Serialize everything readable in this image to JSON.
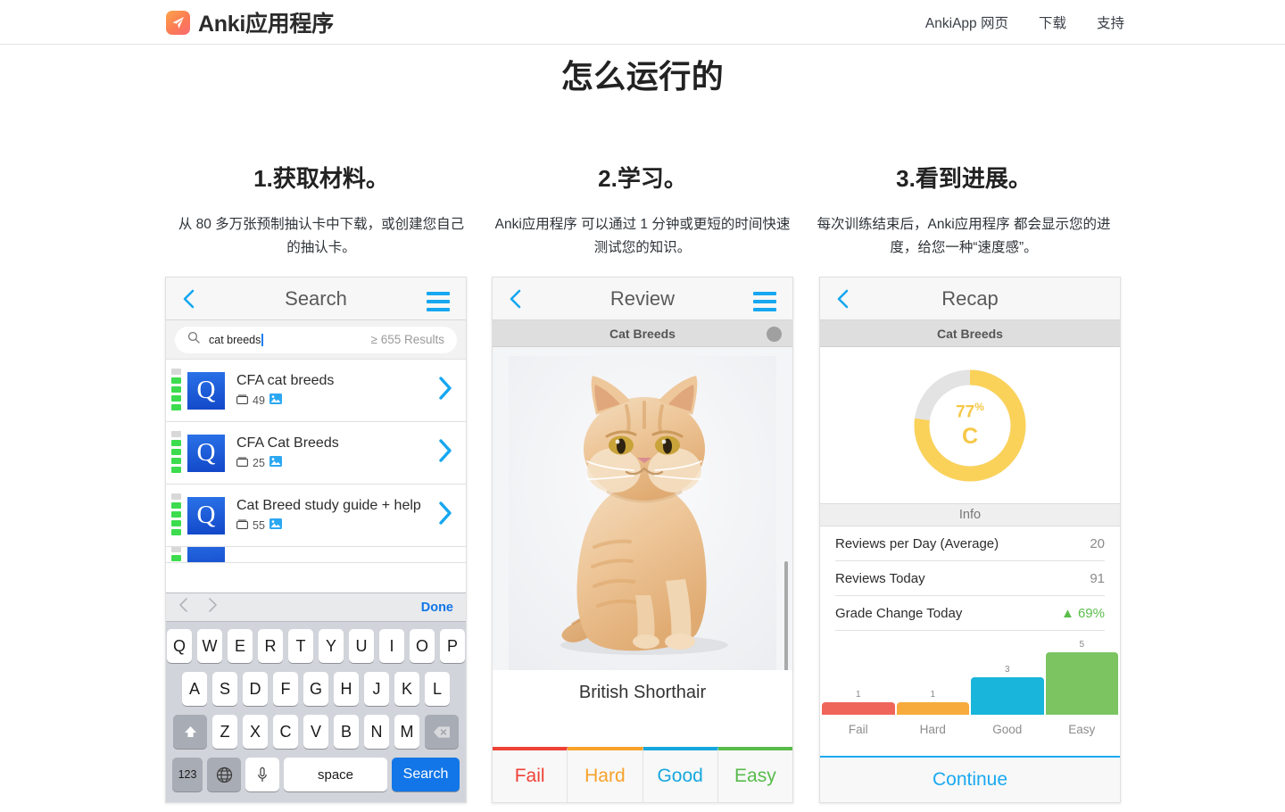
{
  "nav": {
    "brand": "Anki应用程序",
    "logo_icon": "paper-plane-icon",
    "links": [
      {
        "label": "AnkiApp 网页"
      },
      {
        "label": "下载"
      },
      {
        "label": "支持"
      }
    ]
  },
  "page": {
    "title": "怎么运行的"
  },
  "columns": [
    {
      "title": "1.获取材料。",
      "desc": "从 80 多万张预制抽认卡中下载，或创建您自己的抽认卡。"
    },
    {
      "title": "2.学习。",
      "desc": "Anki应用程序 可以通过 1 分钟或更短的时间快速测试您的知识。"
    },
    {
      "title": "3.看到进展。",
      "desc": "每次训练结束后，Anki应用程序 都会显示您的进度，给您一种“速度感”。"
    }
  ],
  "search_screen": {
    "header_title": "Search",
    "back_icon": "chevron-left-icon",
    "menu_icon": "hamburger-menu-icon",
    "search_icon": "magnifier-icon",
    "query": "cat breeds",
    "results_count": "≥ 655 Results",
    "decks": [
      {
        "name": "CFA cat breeds",
        "count": "49",
        "badge": "Q",
        "media_icon": "image-icon"
      },
      {
        "name": "CFA Cat Breeds",
        "count": "25",
        "badge": "Q",
        "media_icon": "image-icon"
      },
      {
        "name": "Cat Breed study guide + help",
        "count": "55",
        "badge": "Q",
        "media_icon": "image-icon"
      }
    ],
    "keyboard": {
      "done_label": "Done",
      "prev_icon": "chevron-left-icon",
      "next_icon": "chevron-right-icon",
      "row1": [
        "Q",
        "W",
        "E",
        "R",
        "T",
        "Y",
        "U",
        "I",
        "O",
        "P"
      ],
      "row2": [
        "A",
        "S",
        "D",
        "F",
        "G",
        "H",
        "J",
        "K",
        "L"
      ],
      "row3": [
        "Z",
        "X",
        "C",
        "V",
        "B",
        "N",
        "M"
      ],
      "shift_icon": "shift-up-arrow-icon",
      "backspace_icon": "backspace-delete-icon",
      "numeric_label": "123",
      "globe_icon": "globe-language-icon",
      "mic_icon": "microphone-icon",
      "space_label": "space",
      "go_label": "Search"
    }
  },
  "review_screen": {
    "header_title": "Review",
    "back_icon": "chevron-left-icon",
    "menu_icon": "hamburger-menu-icon",
    "deck_name": "Cat Breeds",
    "card_image": "british-shorthair-cat-photo",
    "answer_text": "British Shorthair",
    "grade_buttons": [
      {
        "label": "Fail",
        "color": "#ef4136"
      },
      {
        "label": "Hard",
        "color": "#f7a22b"
      },
      {
        "label": "Good",
        "color": "#16a7dd"
      },
      {
        "label": "Easy",
        "color": "#57bb4a"
      }
    ]
  },
  "recap_screen": {
    "header_title": "Recap",
    "back_icon": "chevron-left-icon",
    "deck_name": "Cat Breeds",
    "score": {
      "percent": "77",
      "percent_symbol": "%",
      "grade": "C",
      "ring_color": "#fad25a",
      "track_color": "#e3e3e3",
      "fraction": 0.77
    },
    "info_header": "Info",
    "info_rows": [
      {
        "label": "Reviews per Day (Average)",
        "value": "20",
        "trend": ""
      },
      {
        "label": "Reviews Today",
        "value": "91",
        "trend": ""
      },
      {
        "label": "Grade Change Today",
        "value": "69%",
        "trend": "▲"
      }
    ],
    "continue_label": "Continue",
    "chart_data": {
      "type": "bar",
      "title": "",
      "categories": [
        "Fail",
        "Hard",
        "Good",
        "Easy"
      ],
      "values": [
        1,
        1,
        3,
        5
      ],
      "colors": [
        "#f0655a",
        "#f7ab3d",
        "#19b5da",
        "#7cc462"
      ],
      "xlabel": "",
      "ylabel": "",
      "ylim": [
        0,
        5
      ],
      "grid": false,
      "legend": "none",
      "data_labels": [
        "1",
        "1",
        "3",
        "5"
      ]
    }
  }
}
